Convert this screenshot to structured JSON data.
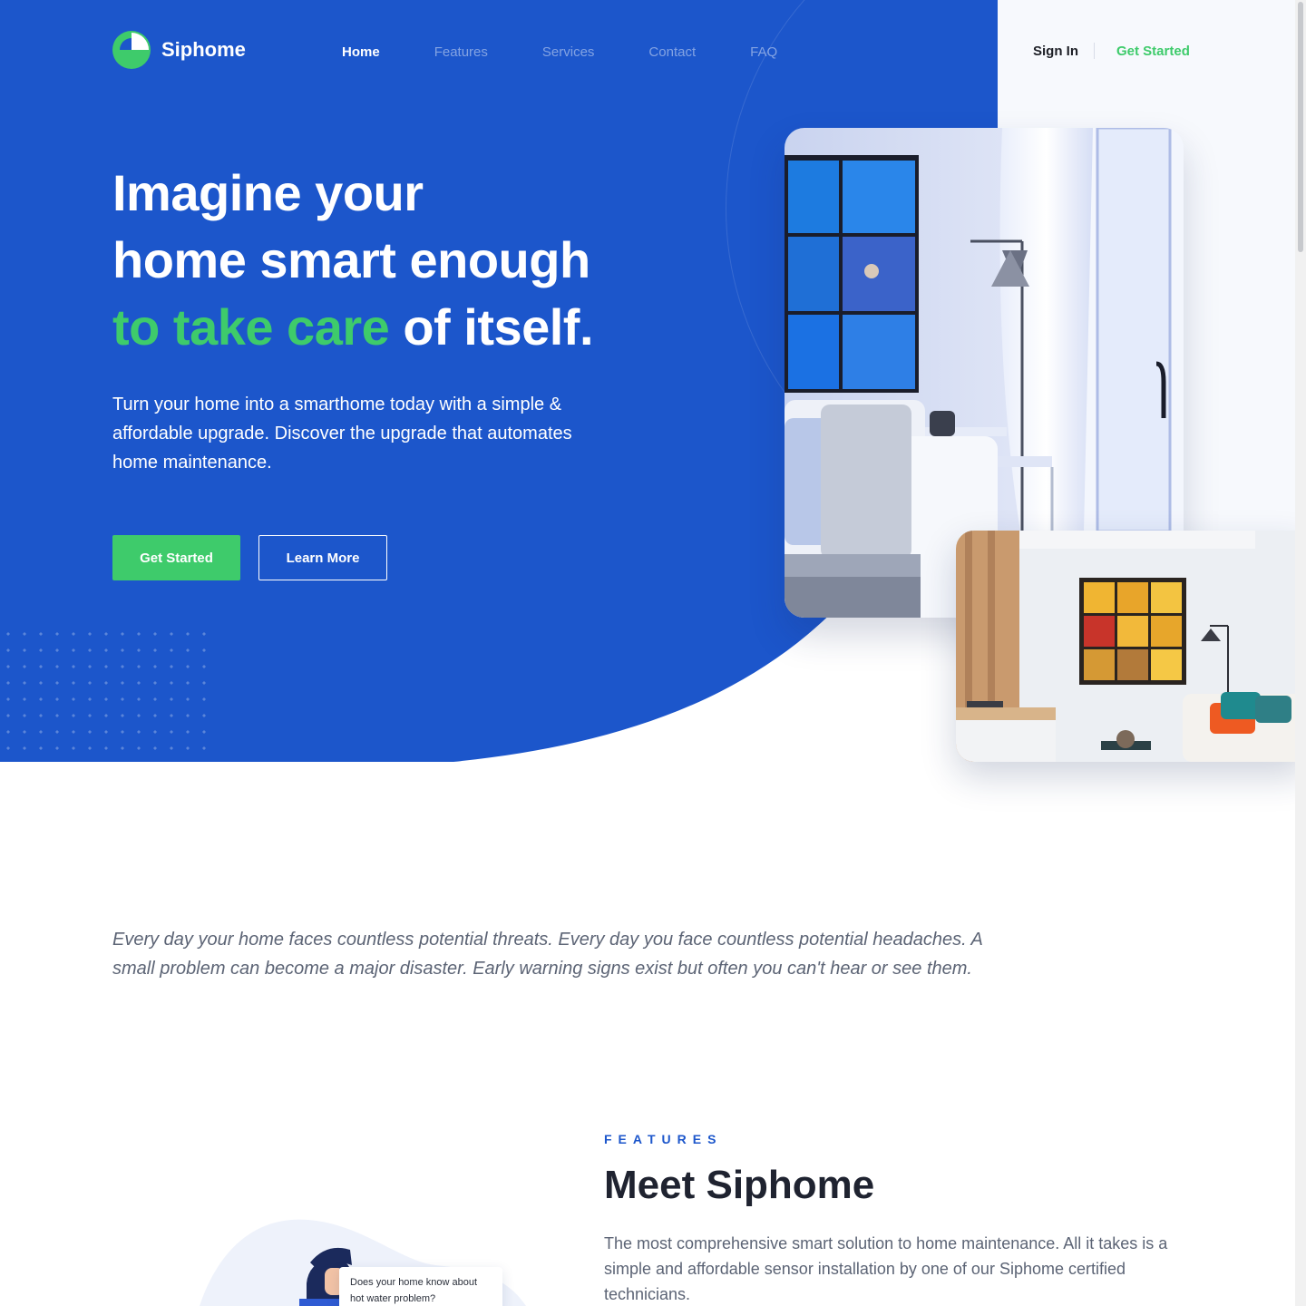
{
  "brand": {
    "name": "Siphome",
    "green": "#3ecb6b",
    "blue": "#1c56cb"
  },
  "nav": {
    "items": [
      {
        "label": "Home",
        "active": true
      },
      {
        "label": "Features",
        "active": false
      },
      {
        "label": "Services",
        "active": false
      },
      {
        "label": "Contact",
        "active": false
      },
      {
        "label": "FAQ",
        "active": false
      }
    ]
  },
  "auth": {
    "signin": "Sign In",
    "get_started": "Get Started"
  },
  "hero": {
    "title_line1": "Imagine your",
    "title_line2": "home smart enough",
    "title_highlight": "to take care",
    "title_rest": " of itself.",
    "subtitle": "Turn your home into a smarthome today with a simple & affordable upgrade. Discover the upgrade that automates home maintenance.",
    "primary_button": "Get Started",
    "secondary_button": "Learn More"
  },
  "intro": {
    "text": "Every day your home faces countless potential threats. Every day you face countless potential headaches. A small problem can become a major disaster. Early warning signs exist but often you can't hear or see them."
  },
  "features": {
    "label": "FEATURES",
    "title": "Meet Siphome",
    "text": "The most comprehensive smart solution to home maintenance. All it takes is a simple and affordable sensor installation by one of our Siphome certified technicians.",
    "bubble": "Does your home know about hot water problem?"
  }
}
